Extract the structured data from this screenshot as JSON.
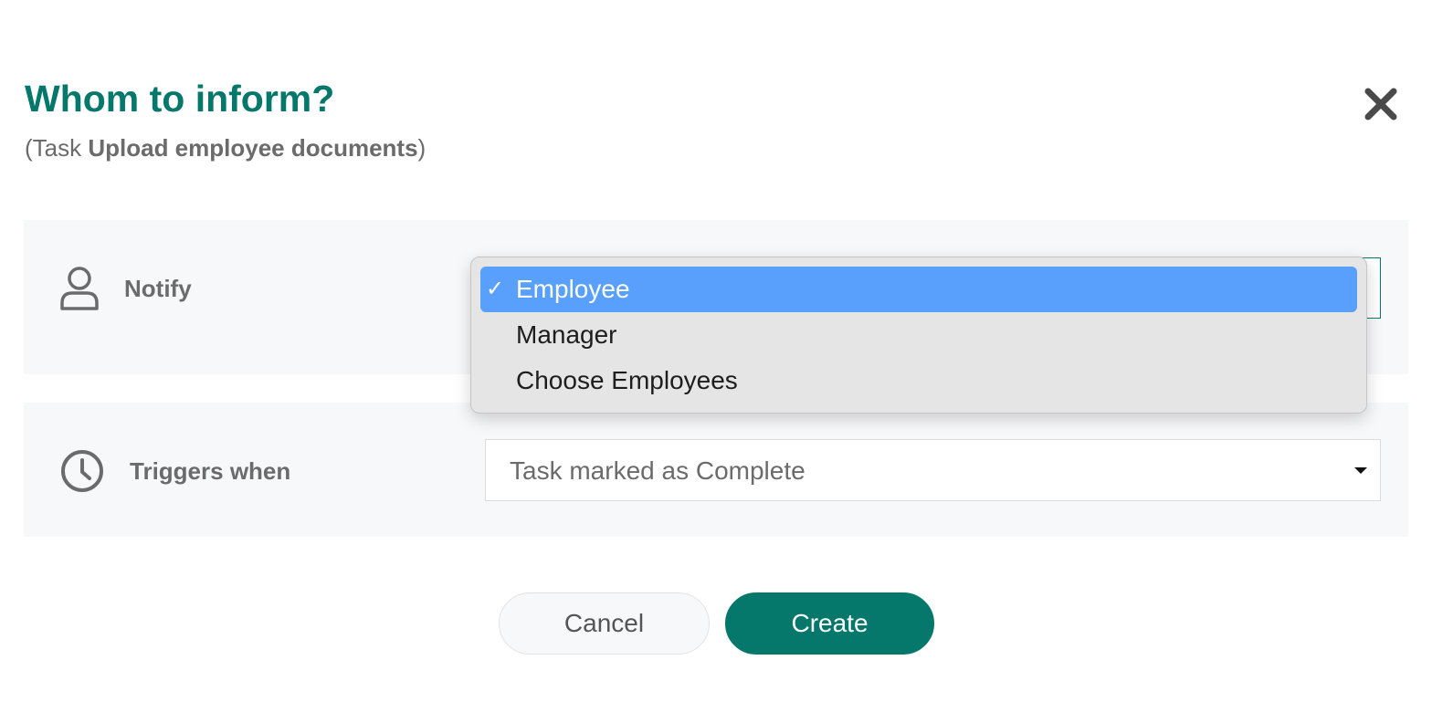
{
  "dialog": {
    "title": "Whom to inform?",
    "subtitle_prefix": "(Task ",
    "task_name": "Upload employee documents",
    "subtitle_suffix": ")",
    "close_icon": "close-icon"
  },
  "notify": {
    "label": "Notify",
    "icon": "user-icon",
    "options": [
      {
        "label": "Employee",
        "selected": true
      },
      {
        "label": "Manager",
        "selected": false
      },
      {
        "label": "Choose Employees",
        "selected": false
      }
    ],
    "check_mark": "✓"
  },
  "trigger": {
    "label": "Triggers when",
    "icon": "clock-icon",
    "value": "Task marked as Complete"
  },
  "buttons": {
    "cancel": "Cancel",
    "create": "Create"
  },
  "colors": {
    "accent": "#05786b",
    "selected_option": "#58a0fc",
    "row_background": "#f7f8fa",
    "muted_text": "#6b6b6b"
  }
}
